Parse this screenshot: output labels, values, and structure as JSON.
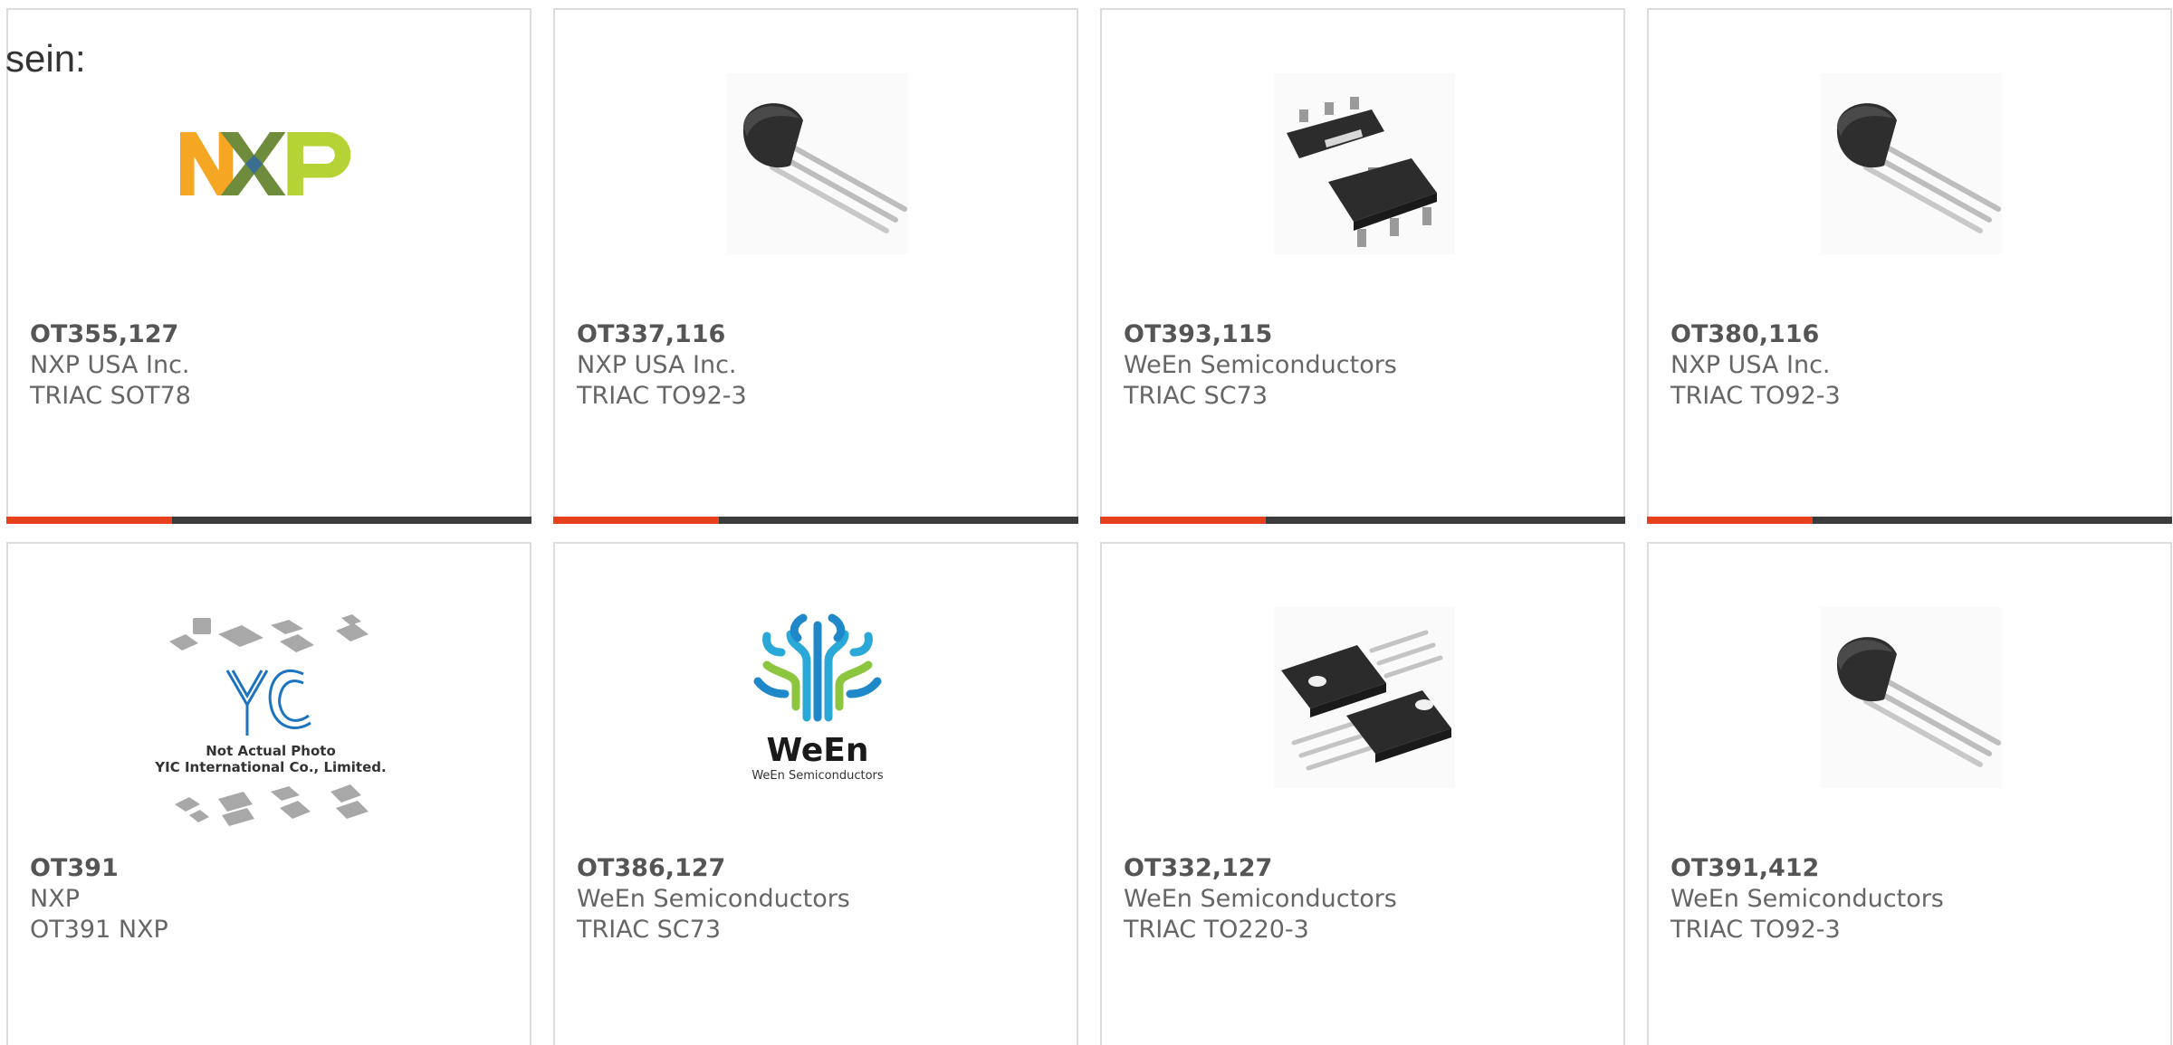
{
  "intro_text": "sein:",
  "products": [
    {
      "part": "OT355,127",
      "maker": "NXP USA Inc.",
      "desc": "TRIAC SOT78",
      "image": "nxp-logo"
    },
    {
      "part": "OT337,116",
      "maker": "NXP USA Inc.",
      "desc": "TRIAC TO92-3",
      "image": "to92-package"
    },
    {
      "part": "OT393,115",
      "maker": "WeEn Semiconductors",
      "desc": "TRIAC SC73",
      "image": "sc73-package"
    },
    {
      "part": "OT380,116",
      "maker": "NXP USA Inc.",
      "desc": "TRIAC TO92-3",
      "image": "to92-package"
    },
    {
      "part": "OT391",
      "maker": "NXP",
      "desc": "OT391 NXP",
      "image": "yic-placeholder",
      "image_text": [
        "Not Actual Photo",
        "YIC International Co., Limited."
      ]
    },
    {
      "part": "OT386,127",
      "maker": "WeEn Semiconductors",
      "desc": "TRIAC SC73",
      "image": "ween-logo",
      "image_text": [
        "WeEn",
        "WeEn Semiconductors"
      ]
    },
    {
      "part": "OT332,127",
      "maker": "WeEn Semiconductors",
      "desc": "TRIAC TO220-3",
      "image": "to220-package"
    },
    {
      "part": "OT391,412",
      "maker": "WeEn Semiconductors",
      "desc": "TRIAC TO92-3",
      "image": "to92-package"
    }
  ],
  "colors": {
    "accent": "#e8401c",
    "bar": "#3b3b3b",
    "border": "#dcdcdc",
    "text": "#666666"
  }
}
